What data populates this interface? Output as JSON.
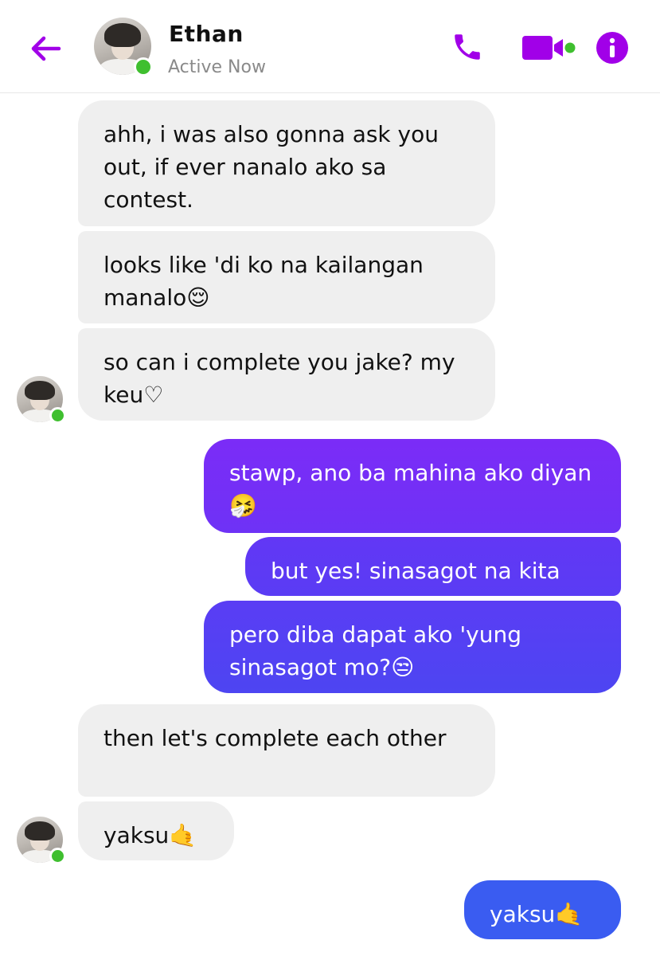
{
  "header": {
    "contact_name": "Ethan",
    "status": "Active Now",
    "accent_color": "#a100e8",
    "online_color": "#3fbf2f"
  },
  "messages": [
    {
      "id": "m1",
      "sender": "contact",
      "text": "ahh, i was also gonna ask you out, if ever nanalo ako sa contest."
    },
    {
      "id": "m2",
      "sender": "contact",
      "text": "looks like 'di ko na kailangan manalo😌"
    },
    {
      "id": "m3",
      "sender": "contact",
      "text": "so can i complete you jake? my keu♡"
    },
    {
      "id": "m4",
      "sender": "me",
      "text": "stawp, ano ba mahina ako diyan🤧"
    },
    {
      "id": "m5",
      "sender": "me",
      "text": "but yes! sinasagot na kita"
    },
    {
      "id": "m6",
      "sender": "me",
      "text": "pero diba dapat ako 'yung sinasagot mo?😒"
    },
    {
      "id": "m7",
      "sender": "contact",
      "text": "then let's complete each other"
    },
    {
      "id": "m8",
      "sender": "contact",
      "text": "yaksu🤙"
    },
    {
      "id": "m9",
      "sender": "me",
      "text": "yaksu🤙"
    }
  ],
  "icons": {
    "back": "back-arrow-icon",
    "call": "phone-icon",
    "video": "video-camera-icon",
    "info": "info-icon"
  }
}
